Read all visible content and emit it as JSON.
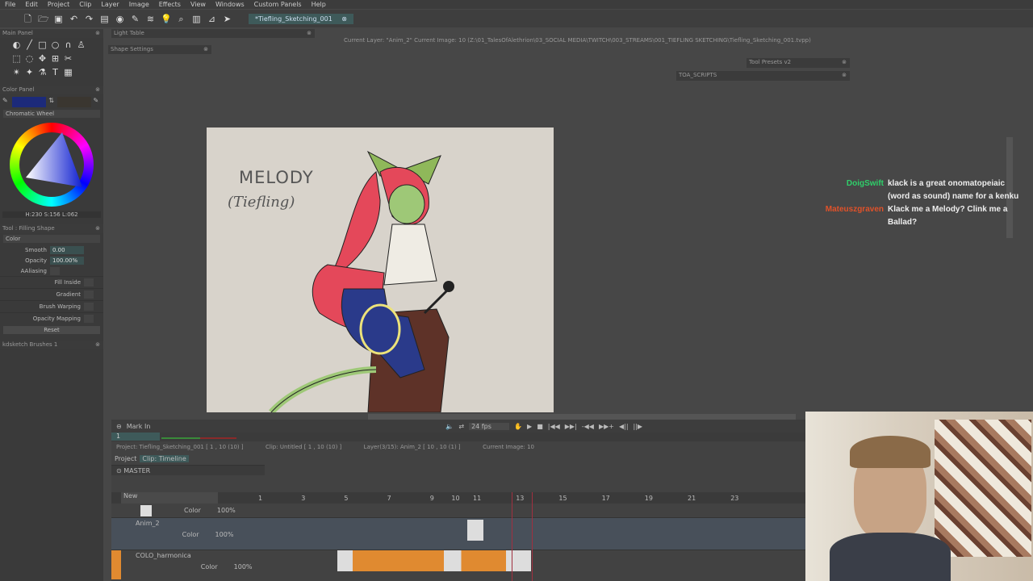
{
  "menu": [
    "File",
    "Edit",
    "Project",
    "Clip",
    "Layer",
    "Image",
    "Effects",
    "View",
    "Windows",
    "Custom Panels",
    "Help"
  ],
  "document_tab": "*Tiefling_Sketching_001",
  "panels": {
    "main": "Main Panel",
    "light_table": "Light Table",
    "shape_settings": "Shape Settings",
    "color_panel": "Color Panel",
    "tool": "Tool : Filling Shape",
    "brushes": "kdsketch Brushes 1",
    "tool_presets": "Tool Presets v2",
    "toa_scripts": "TOA_SCRIPTS"
  },
  "status_line": "Current Layer: \"Anim_2\"  Current Image: 10 (Z:\\01_TalesOfAlethrion\\03_SOCIAL MEDIA\\TWITCH\\003_STREAMS\\001_TIEFLING SKETCHING\\Tiefling_Sketching_001.tvpp)",
  "color": {
    "mode": "Chromatic Wheel",
    "readout": "H:230 S:156 L:062",
    "primary": "#1c2a7a",
    "secondary": "#3a3630"
  },
  "tool": {
    "section": "Color",
    "smooth_label": "Smooth",
    "smooth": "0.00",
    "opacity_label": "Opacity",
    "opacity": "100.00%",
    "aaliasing": "AAliasing",
    "options": [
      "Fill Inside",
      "Gradient",
      "Brush Warping",
      "Opacity Mapping"
    ],
    "reset": "Reset"
  },
  "canvas": {
    "title": "MELODY",
    "subtitle": "(Tiefling)"
  },
  "chat": [
    {
      "user": "DoigSwift",
      "color": "#2fcf6a",
      "text": "klack is a great onomatopeiaic (word as sound) name for a kenku"
    },
    {
      "user": "Mateuszgraven",
      "color": "#e0522a",
      "text": "Klack me a Melody? Clink me a Ballad?"
    }
  ],
  "timeline": {
    "mark_in": "Mark In",
    "frame_field": "1",
    "fps": "24 fps",
    "info": {
      "project": "Project: Tiefling_Sketching_001 [ 1 , 10  (10) ]",
      "clip": "Clip: Untitled [ 1 , 10  (10) ]",
      "layer": "Layer(3/15): Anim_2 [ 10 , 10  (1) ]",
      "current": "Current Image: 10"
    },
    "tabs": [
      "Project",
      "Clip: Timeline"
    ],
    "master": "MASTER",
    "new": "New",
    "frames": [
      "1",
      "3",
      "5",
      "7",
      "9",
      "10",
      "11",
      "13",
      "15",
      "17",
      "19",
      "21",
      "23"
    ],
    "layers": [
      {
        "name": "",
        "blend": "Color",
        "opacity": "100%"
      },
      {
        "name": "Anim_2",
        "blend": "Color",
        "opacity": "100%"
      },
      {
        "name": "COLO_harmonica",
        "blend": "Color",
        "opacity": "100%"
      }
    ]
  }
}
